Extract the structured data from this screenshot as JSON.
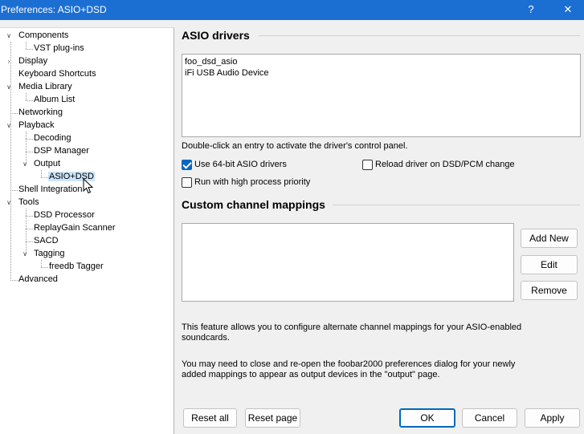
{
  "window": {
    "title": "Preferences: ASIO+DSD",
    "help_label": "?",
    "close_label": "✕"
  },
  "tree": {
    "components": "Components",
    "vst": "VST plug-ins",
    "display": "Display",
    "keyboard": "Keyboard Shortcuts",
    "media_library": "Media Library",
    "album_list": "Album List",
    "networking": "Networking",
    "playback": "Playback",
    "decoding": "Decoding",
    "dsp_manager": "DSP Manager",
    "output": "Output",
    "asio_dsd": "ASIO+DSD",
    "shell": "Shell Integration",
    "tools": "Tools",
    "dsd_processor": "DSD Processor",
    "replaygain": "ReplayGain Scanner",
    "sacd": "SACD",
    "tagging": "Tagging",
    "freedb": "freedb Tagger",
    "advanced": "Advanced",
    "selected": "ASIO+DSD"
  },
  "asio": {
    "heading": "ASIO drivers",
    "drivers": [
      "foo_dsd_asio",
      "iFi USB Audio Device"
    ],
    "hint": "Double-click an entry to activate the driver's control panel.",
    "use64_label": "Use 64-bit ASIO drivers",
    "use64_checked": true,
    "reload_label": "Reload driver on DSD/PCM change",
    "reload_checked": false,
    "highprio_label": "Run with high process priority",
    "highprio_checked": false
  },
  "mappings": {
    "heading": "Custom channel mappings",
    "add_new": "Add New",
    "edit": "Edit",
    "remove": "Remove",
    "info1": "This feature allows you to configure alternate channel mappings for your ASIO-enabled soundcards.",
    "info2": "You may need to close and re-open the foobar2000 preferences dialog for your newly added mappings to appear as output devices in the \"output\" page."
  },
  "footer": {
    "reset_all": "Reset all",
    "reset_page": "Reset page",
    "ok": "OK",
    "cancel": "Cancel",
    "apply": "Apply"
  },
  "colors": {
    "titlebar": "#1c6fd2",
    "selection": "#cce4f7",
    "checkbox_accent": "#0067c0"
  }
}
